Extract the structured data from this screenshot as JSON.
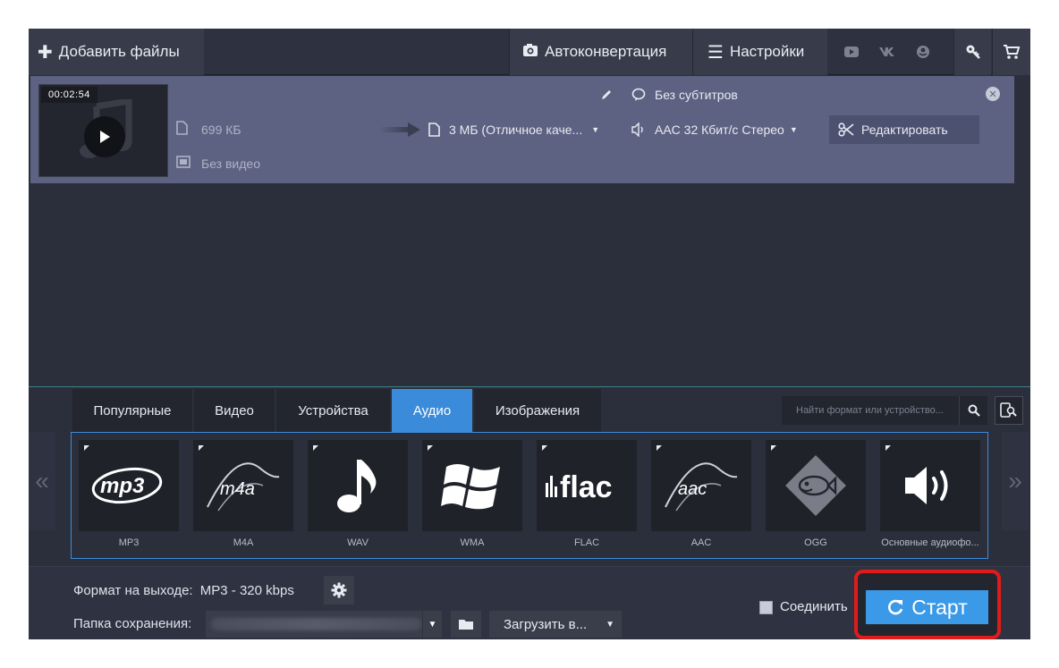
{
  "toolbar": {
    "add_files": "Добавить файлы",
    "autoconvert": "Автоконвертация",
    "settings": "Настройки",
    "social": [
      "youtube-icon",
      "vk-icon",
      "odnoklassniki-icon"
    ]
  },
  "file": {
    "duration": "00:02:54",
    "size": "699 КБ",
    "video": "Без видео",
    "output_size": "3 МБ (Отличное каче...",
    "subtitles": "Без субтитров",
    "audio": "AAC 32 Кбит/с Стерео",
    "edit": "Редактировать"
  },
  "formats": {
    "tabs": [
      {
        "label": "Популярные",
        "active": false
      },
      {
        "label": "Видео",
        "active": false
      },
      {
        "label": "Устройства",
        "active": false
      },
      {
        "label": "Аудио",
        "active": true
      },
      {
        "label": "Изображения",
        "active": false
      }
    ],
    "search_placeholder": "Найти формат или устройство...",
    "items": [
      {
        "label": "MP3",
        "logo": "mp3"
      },
      {
        "label": "M4A",
        "logo": "m4a"
      },
      {
        "label": "WAV",
        "logo": "note"
      },
      {
        "label": "WMA",
        "logo": "windows"
      },
      {
        "label": "FLAC",
        "logo": "flac"
      },
      {
        "label": "AAC",
        "logo": "aac"
      },
      {
        "label": "OGG",
        "logo": "fish"
      },
      {
        "label": "Основные аудиофо...",
        "logo": "speaker"
      }
    ]
  },
  "bottom": {
    "output_format_label": "Формат на выходе:",
    "output_format_value": "MP3 - 320 kbps",
    "save_folder_label": "Папка сохранения:",
    "upload": "Загрузить в...",
    "join": "Соединить",
    "start": "Старт"
  },
  "colors": {
    "accent": "#3b9ae8",
    "file_row": "#5d6282",
    "highlight": "#e01b1b"
  }
}
